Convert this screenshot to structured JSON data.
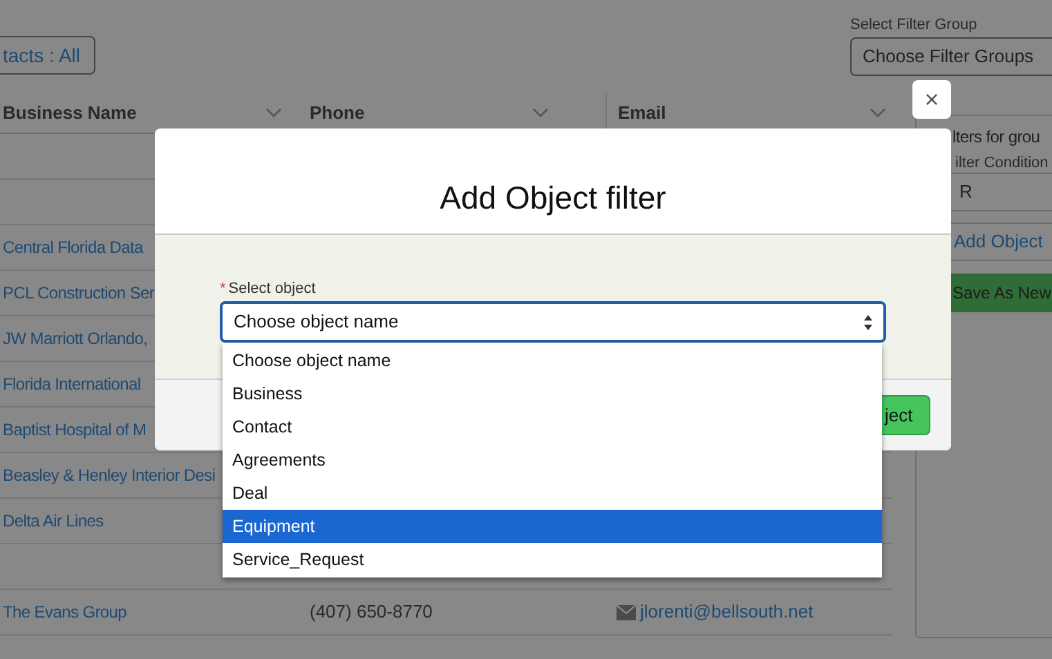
{
  "contacts_filter_button": {
    "label": "tacts : All"
  },
  "filter_group": {
    "label": "Select Filter Group",
    "value": "Choose Filter Groups"
  },
  "table": {
    "columns": [
      "Business Name",
      "Phone",
      "Email"
    ],
    "rows": [
      {
        "kind": "blank"
      },
      {
        "kind": "blank"
      },
      {
        "kind": "record",
        "business_name": "Central Florida Data"
      },
      {
        "kind": "record",
        "business_name": "PCL Construction Ser"
      },
      {
        "kind": "record",
        "business_name": "JW Marriott Orlando,"
      },
      {
        "kind": "record",
        "business_name": "Florida International"
      },
      {
        "kind": "record",
        "business_name": "Baptist Hospital of M"
      },
      {
        "kind": "record",
        "business_name": "Beasley & Henley Interior Desi"
      },
      {
        "kind": "record",
        "business_name": "Delta Air Lines"
      },
      {
        "kind": "blank"
      },
      {
        "kind": "record",
        "business_name": "The Evans Group",
        "phone": "(407) 650-8770",
        "email": "jlorenti@bellsouth.net"
      }
    ]
  },
  "filters_panel": {
    "title": "lters for grou",
    "condition_label": "ilter Condition",
    "condition_value": "R",
    "add_object_button": "Add Object",
    "save_button": "Save As New"
  },
  "close_button": {
    "label": "×"
  },
  "modal": {
    "title": "Add Object filter",
    "field": {
      "label": "Select object",
      "required_mark": "*",
      "value": "Choose object name"
    },
    "options": [
      {
        "label": "Choose object name",
        "selected": false
      },
      {
        "label": "Business",
        "selected": false
      },
      {
        "label": "Contact",
        "selected": false
      },
      {
        "label": "Agreements",
        "selected": false
      },
      {
        "label": "Deal",
        "selected": false
      },
      {
        "label": "Equipment",
        "selected": true
      },
      {
        "label": "Service_Request",
        "selected": false
      }
    ],
    "confirm_button": "ject"
  }
}
